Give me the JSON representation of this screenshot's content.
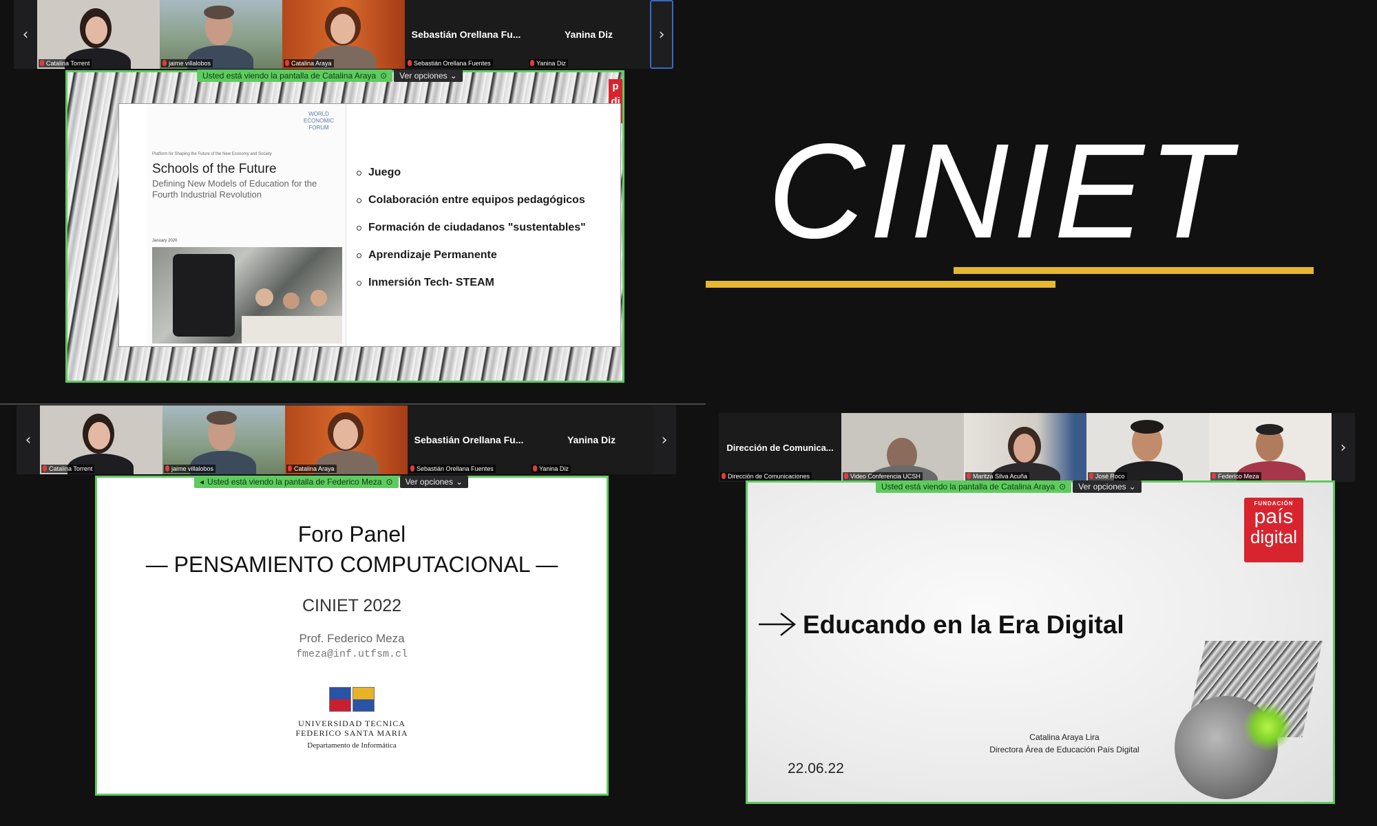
{
  "panels": {
    "top_left": {
      "participants": [
        {
          "tile_name": "",
          "label": "Catalina Torrent"
        },
        {
          "tile_name": "",
          "label": "jaime villalobos"
        },
        {
          "tile_name": "",
          "label": "Catalina Araya"
        },
        {
          "tile_name": "Sebastián Orellana Fu...",
          "label": "Sebastián Orellana Fuentes"
        },
        {
          "tile_name": "Yanina Diz",
          "label": "Yanina Diz"
        }
      ],
      "share_notice": "Usted está viendo la pantalla de Catalina Araya",
      "options_label": "Ver opciones",
      "slide": {
        "wef_logo": "WORLD ECONOMIC FORUM",
        "small_header": "Platform for Shaping the Future of the New Economy and Society",
        "doc_title": "Schools of the Future",
        "doc_subtitle": "Defining New Models of Education for the Fourth Industrial Revolution",
        "doc_date": "January 2020",
        "bullets": [
          "Juego",
          "Colaboración entre equipos pedagógicos",
          "Formación de ciudadanos \"sustentables\"",
          "Aprendizaje Permanente",
          "Inmersión Tech- STEAM"
        ]
      }
    },
    "top_right": {
      "brand": "CINIET",
      "accent_color": "#e6b832"
    },
    "bottom_left": {
      "participants": [
        {
          "tile_name": "",
          "label": "Catalina Torrent"
        },
        {
          "tile_name": "",
          "label": "jaime villalobos"
        },
        {
          "tile_name": "",
          "label": "Catalina Araya"
        },
        {
          "tile_name": "Sebastián Orellana Fu...",
          "label": "Sebastián Orellana Fuentes"
        },
        {
          "tile_name": "Yanina Diz",
          "label": "Yanina Diz"
        }
      ],
      "share_notice": "Usted está viendo la pantalla de Federico Meza",
      "options_label": "Ver opciones",
      "slide": {
        "title_line1": "Foro Panel",
        "title_line2": "— PENSAMIENTO COMPUTACIONAL —",
        "event": "CINIET 2022",
        "presenter": "Prof. Federico Meza",
        "email": "fmeza@inf.utfsm.cl",
        "university_line1": "UNIVERSIDAD TECNICA",
        "university_line2": "FEDERICO SANTA MARIA",
        "department": "Departamento de Informática"
      }
    },
    "bottom_right": {
      "participants": [
        {
          "tile_name": "Dirección de Comunica...",
          "label": "Dirección de Comunicaciones"
        },
        {
          "tile_name": "",
          "label": "Video Conferencia UCSH"
        },
        {
          "tile_name": "",
          "label": "Maritza Silva Acuña"
        },
        {
          "tile_name": "",
          "label": "José Roco"
        },
        {
          "tile_name": "",
          "label": "Federico Meza"
        }
      ],
      "share_notice": "Usted está viendo la pantalla de Catalina Araya",
      "options_label": "Ver opciones",
      "slide": {
        "logo_top": "FUNDACIÓN",
        "logo_line1": "país",
        "logo_line2": "digital",
        "title": "Educando en la Era Digital",
        "speaker_name": "Catalina Araya Lira",
        "speaker_role": "Directora Área de Educación País Digital",
        "date": "22.06.22"
      }
    }
  }
}
